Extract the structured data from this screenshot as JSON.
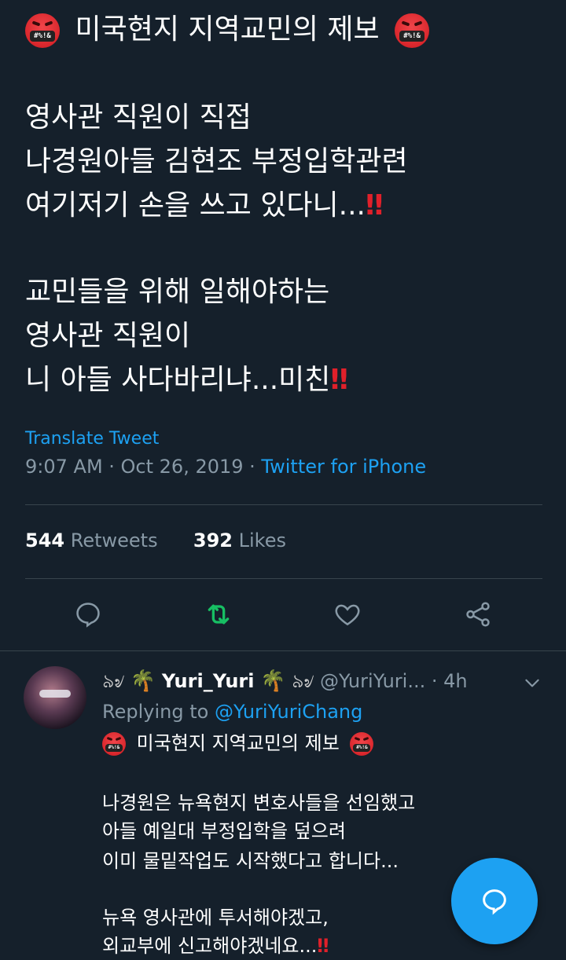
{
  "tweet": {
    "title": "미국현지 지역교민의 제보",
    "line1": "영사관 직원이 직접",
    "line2": "나경원아들 김현조 부정입학관련",
    "line3": "여기저기 손을 쓰고 있다니...",
    "line4": "교민들을 위해 일해야하는",
    "line5": "영사관 직원이",
    "line6": "니 아들 사다바리냐...미친",
    "emoji_text": "#%!&",
    "bang": "‼",
    "translate": "Translate Tweet",
    "time": "9:07 AM · Oct 26, 2019 · ",
    "source": "Twitter for iPhone"
  },
  "stats": {
    "retweets_count": "544",
    "retweets_label": "Retweets",
    "likes_count": "392",
    "likes_label": "Likes"
  },
  "actions": {
    "reply_icon": "reply-icon",
    "retweet_icon": "retweet-icon",
    "like_icon": "heart-icon",
    "share_icon": "share-icon"
  },
  "reply": {
    "deco_left": "৯৶",
    "palm": "🌴",
    "name": "Yuri_Yuri",
    "deco_right": "৯৶",
    "handle": "@YuriYuri...",
    "sep": " · ",
    "age": "4h",
    "replying_label": "Replying to ",
    "replying_to": "@YuriYuriChang",
    "title": "미국현지 지역교민의 제보",
    "line1": "나경원은 뉴욕현지 변호사들을 선임했고",
    "line2": "아들 예일대 부정입학을 덮으려",
    "line3": "이미 물밑작업도 시작했다고 합니다...",
    "line4": "뉴욕 영사관에 투서해야겠고,",
    "line5": "외교부에 신고해야겠네요..."
  },
  "colors": {
    "background": "#15202b",
    "accent": "#1da1f2",
    "retweet_green": "#17bf63",
    "muted": "#8899a6",
    "divider": "#38444d"
  }
}
